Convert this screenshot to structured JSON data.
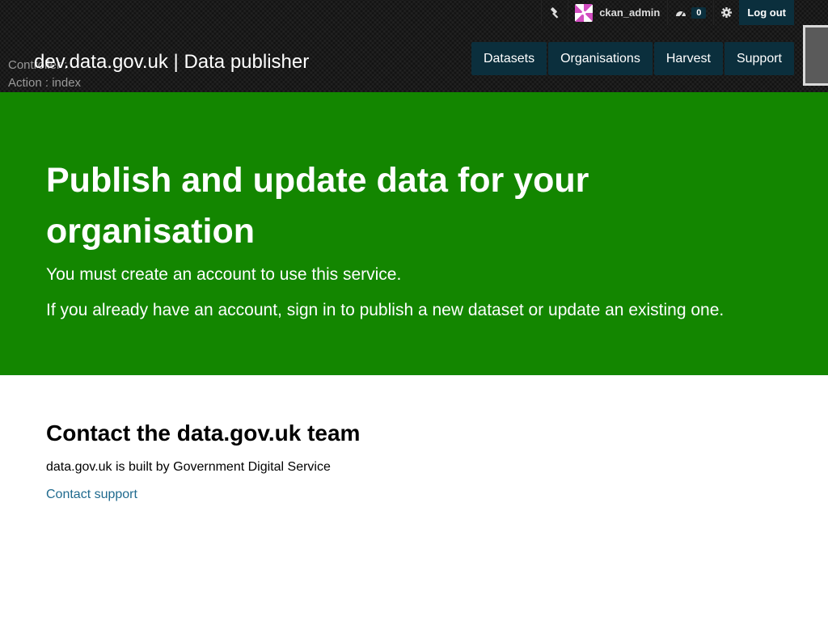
{
  "debug": {
    "controller": "Controller :",
    "action": "Action : index"
  },
  "header": {
    "site_title": "dev.data.gov.uk | Data publisher",
    "account": {
      "sysadmin_icon": "hammer-icon",
      "username": "ckan_admin",
      "dashboard_icon": "dashboard-icon",
      "dashboard_count": "0",
      "settings_icon": "gear-icon",
      "logout_label": "Log out"
    },
    "nav": [
      {
        "label": "Datasets"
      },
      {
        "label": "Organisations"
      },
      {
        "label": "Harvest"
      },
      {
        "label": "Support"
      }
    ]
  },
  "hero": {
    "title": "Publish and update data for your organisation",
    "line1": "You must create an account to use this service.",
    "line2": "If you already have an account, sign in to publish a new dataset or update an existing one."
  },
  "contact": {
    "title": "Contact the data.gov.uk team",
    "text": "data.gov.uk is built by Government Digital Service",
    "link": "Contact support"
  },
  "colors": {
    "hero_bg": "#138600",
    "nav_bg": "#0b2f3d",
    "link": "#1f6a8e"
  }
}
